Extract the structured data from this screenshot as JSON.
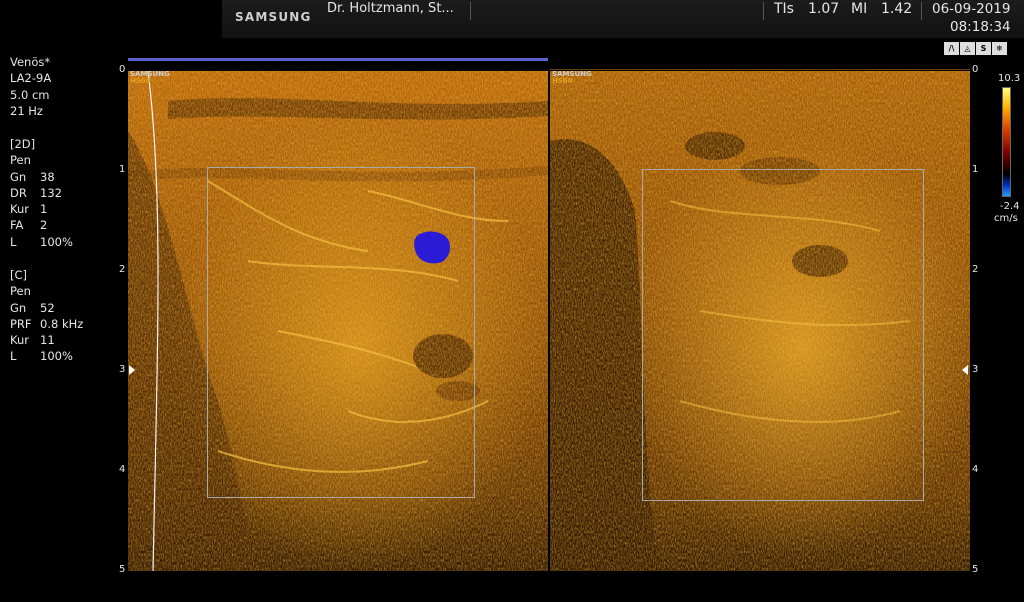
{
  "header": {
    "brand": "SAMSUNG",
    "physician": "Dr. Holtzmann, St...",
    "tis_label": "TIs",
    "tis_value": "1.07",
    "mi_label": "MI",
    "mi_value": "1.42",
    "date": "06-09-2019",
    "time": "08:18:34"
  },
  "status_icons": [
    "probe-icon",
    "scan-icon",
    "harmonic-icon",
    "freeze-icon"
  ],
  "status_icon_labels": [
    "/\\",
    "◬",
    "S",
    "❄"
  ],
  "preset": {
    "name": "Venös*",
    "probe": "LA2-9A",
    "depth": "5.0 cm",
    "frame_rate": "21 Hz"
  },
  "mode_2d": {
    "title": "[2D]",
    "mode": "Pen",
    "rows": [
      {
        "k": "Gn",
        "v": "38"
      },
      {
        "k": "DR",
        "v": "132"
      },
      {
        "k": "Kur",
        "v": "1"
      },
      {
        "k": "FA",
        "v": "2"
      },
      {
        "k": "L",
        "v": "100%"
      }
    ]
  },
  "mode_c": {
    "title": "[C]",
    "mode": "Pen",
    "rows": [
      {
        "k": "Gn",
        "v": "52"
      },
      {
        "k": "PRF",
        "v": "0.8 kHz"
      },
      {
        "k": "Kur",
        "v": "11"
      },
      {
        "k": "L",
        "v": "100%"
      }
    ]
  },
  "depth_scale": [
    "0",
    "1",
    "2",
    "3",
    "4",
    "5"
  ],
  "watermark": {
    "line1": "SAMSUNG",
    "line2": "HS60"
  },
  "color_scale": {
    "max": "10.3",
    "min": "-2.4",
    "unit": "cm/s"
  },
  "colors": {
    "tissue": "#c87a10",
    "flow": "#2a1bd6",
    "roi": "#a9a9a9"
  }
}
